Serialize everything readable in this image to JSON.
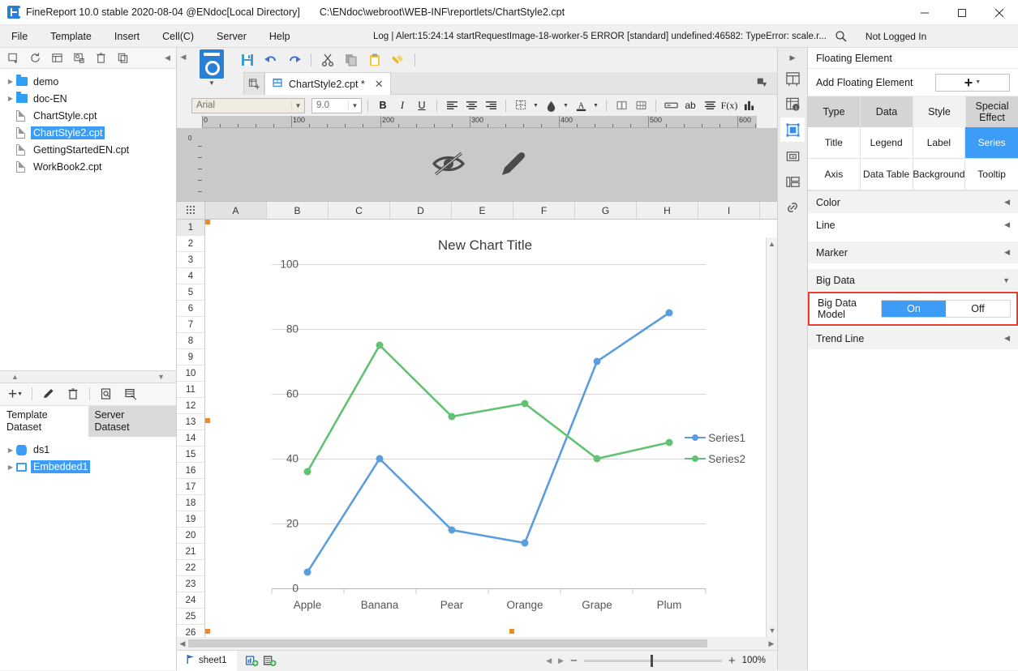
{
  "titlebar": {
    "app_title": "FineReport 10.0 stable 2020-08-04 @ENdoc[Local Directory]",
    "file_path": "C:\\ENdoc\\webroot\\WEB-INF\\reportlets/ChartStyle2.cpt",
    "minimize": "minimize-icon",
    "maximize": "maximize-icon",
    "close": "close-icon"
  },
  "menubar": {
    "items": [
      "File",
      "Template",
      "Insert",
      "Cell(C)",
      "Server",
      "Help"
    ],
    "log_text": "Log | Alert:15:24:14 startRequestImage-18-worker-5 ERROR [standard] undefined:46582: TypeError: scale.r...",
    "login_status": "Not Logged In"
  },
  "left_panel": {
    "toolbar_icons": [
      "new-template-icon",
      "refresh-icon",
      "show-panel-icon",
      "settings-icon",
      "delete-icon",
      "copy-icon"
    ],
    "collapse": "collapse-left-icon",
    "tree": [
      {
        "label": "demo",
        "type": "folder",
        "expandable": true,
        "selected": false
      },
      {
        "label": "doc-EN",
        "type": "folder",
        "expandable": true,
        "selected": false
      },
      {
        "label": "ChartStyle.cpt",
        "type": "file",
        "expandable": false,
        "selected": false
      },
      {
        "label": "ChartStyle2.cpt",
        "type": "file",
        "expandable": false,
        "selected": true
      },
      {
        "label": "GettingStartedEN.cpt",
        "type": "file",
        "expandable": false,
        "selected": false
      },
      {
        "label": "WorkBook2.cpt",
        "type": "file",
        "expandable": false,
        "selected": false
      }
    ],
    "dataset_toolbar": [
      "add-icon",
      "edit-icon",
      "delete-icon",
      "preview-icon",
      "dataset-settings-icon"
    ],
    "tabs": [
      {
        "line1": "Template",
        "line2": "Dataset",
        "active": true
      },
      {
        "line1": "Server",
        "line2": "Dataset",
        "active": false
      }
    ],
    "datasets": [
      {
        "label": "ds1",
        "icon": "database-icon",
        "selected": false
      },
      {
        "label": "Embedded1",
        "icon": "embedded-dataset-icon",
        "selected": true
      }
    ]
  },
  "center": {
    "toolbar_icons": [
      "save-icon",
      "undo-icon",
      "redo-icon",
      "cut-icon",
      "copy-icon",
      "paste-icon",
      "format-painter-icon"
    ],
    "preview_icon": "preview-template-icon",
    "tab_add": "add-tab-icon",
    "doc_tab": {
      "label": "ChartStyle2.cpt *",
      "icon": "report-icon",
      "close": "close-icon"
    },
    "tabrow_menu": "tab-options-icon",
    "format_bar": {
      "font_family": "Arial",
      "font_size": "9.0",
      "bold": "B",
      "italic": "I",
      "underline": "U",
      "align_left": "align-left-icon",
      "align_center": "align-center-icon",
      "align_right": "align-right-icon",
      "borders": "borders-icon",
      "fill_color": "fill-color-icon",
      "font_color": "font-color-icon",
      "merge": "merge-cells-icon",
      "unmerge": "unmerge-cells-icon",
      "widget": "widget-icon",
      "text": "ab",
      "list": "list-icon",
      "formula": "F(x)",
      "chart": "chart-icon"
    },
    "ruler_labels": [
      "0",
      "100",
      "200",
      "300",
      "400",
      "500",
      "600"
    ],
    "gray_band_icons": [
      "eye-off-icon",
      "pencil-icon"
    ],
    "columns": [
      "A",
      "B",
      "C",
      "D",
      "E",
      "F",
      "G",
      "H",
      "I"
    ],
    "selected_column": "E",
    "rows": [
      "1",
      "2",
      "3",
      "4",
      "5",
      "6",
      "7",
      "8",
      "9",
      "10",
      "11",
      "12",
      "13",
      "14",
      "15",
      "16",
      "17",
      "18",
      "19",
      "20",
      "21",
      "22",
      "23",
      "24",
      "25",
      "26"
    ],
    "selected_row": "1"
  },
  "chart_data": {
    "type": "line",
    "title": "New Chart Title",
    "xlabel": "",
    "ylabel": "",
    "categories": [
      "Apple",
      "Banana",
      "Pear",
      "Orange",
      "Grape",
      "Plum"
    ],
    "ylim": [
      0,
      100
    ],
    "yticks": [
      0,
      20,
      40,
      60,
      80,
      100
    ],
    "grid": true,
    "legend_position": "right",
    "series": [
      {
        "name": "Series1",
        "color": "#5b9ee0",
        "values": [
          5,
          40,
          18,
          14,
          70,
          85
        ]
      },
      {
        "name": "Series2",
        "color": "#62c271",
        "values": [
          36,
          75,
          53,
          57,
          40,
          45
        ]
      }
    ]
  },
  "statusbar": {
    "sheet_name": "sheet1",
    "sheet_icons": [
      "add-sheet-icon",
      "add-report-sheet-icon"
    ],
    "nav_prev": "prev-sheet-icon",
    "nav_next": "next-sheet-icon",
    "zoom_out": "−",
    "zoom_in": "+",
    "zoom_level": "100%"
  },
  "right_strip": {
    "caret": "expand-icon",
    "items": [
      {
        "name": "cell-element-icon",
        "active": false
      },
      {
        "name": "cell-attribute-icon",
        "active": false
      },
      {
        "name": "floating-element-icon",
        "active": true
      },
      {
        "name": "widget-settings-icon",
        "active": false
      },
      {
        "name": "layout-icon",
        "active": false
      },
      {
        "name": "hyperlink-icon",
        "active": false
      }
    ]
  },
  "right_panel": {
    "header": "Floating Element",
    "add_label": "Add Floating Element",
    "add_button": "+",
    "add_button_caret": "chevron-down-icon",
    "tabs": [
      {
        "label": "Type",
        "selected": false
      },
      {
        "label": "Data",
        "selected": false
      },
      {
        "label": "Style",
        "selected": true
      },
      {
        "label": "Special Effect",
        "selected": false
      }
    ],
    "subtabs": [
      {
        "label": "Title",
        "selected": false
      },
      {
        "label": "Legend",
        "selected": false
      },
      {
        "label": "Label",
        "selected": false
      },
      {
        "label": "Series",
        "selected": true
      },
      {
        "label": "Axis",
        "selected": false
      },
      {
        "label": "Data Table",
        "selected": false
      },
      {
        "label": "Background",
        "selected": false
      },
      {
        "label": "Tooltip",
        "selected": false
      }
    ],
    "sections": [
      {
        "label": "Color",
        "caret": "collapse-icon",
        "white": false
      },
      {
        "label": "Line",
        "caret": "collapse-icon",
        "white": true
      },
      {
        "label": "Marker",
        "caret": "collapse-icon",
        "white": false
      },
      {
        "label": "Big Data",
        "caret": "expanded-icon",
        "white": false
      }
    ],
    "big_data_model": {
      "label": "Big Data Model",
      "options": [
        "On",
        "Off"
      ],
      "selected": "On",
      "highlight_color": "#ec3c2d"
    },
    "trend_line": {
      "label": "Trend Line",
      "caret": "collapse-icon"
    }
  }
}
